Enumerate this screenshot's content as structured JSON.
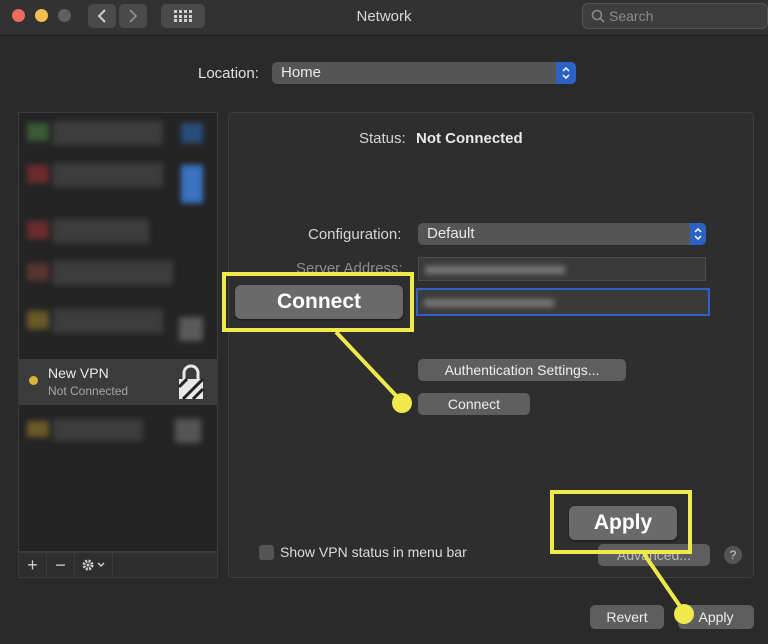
{
  "window": {
    "title": "Network",
    "search_placeholder": "Search"
  },
  "location": {
    "label": "Location:",
    "value": "Home"
  },
  "sidebar": {
    "vpn_item": {
      "name": "New VPN",
      "status": "Not Connected",
      "dot_color": "#d9b43d"
    },
    "add_label": "+",
    "remove_label": "−"
  },
  "panel": {
    "status_label": "Status:",
    "status_value": "Not Connected",
    "configuration_label": "Configuration:",
    "configuration_value": "Default",
    "server_address_label": "Server Address:",
    "auth_settings_label": "Authentication Settings...",
    "connect_label": "Connect",
    "show_vpn_status_label": "Show VPN status in menu bar",
    "advanced_label": "Advanced...",
    "help_label": "?"
  },
  "footer": {
    "revert_label": "Revert",
    "apply_label": "Apply"
  },
  "callouts": {
    "connect_label": "Connect",
    "apply_label": "Apply",
    "color": "#efe94c"
  },
  "colors": {
    "accent": "#2c62c6",
    "traffic_close": "#ec6a5e",
    "traffic_min": "#f4bf4f",
    "traffic_max": "#5f5f5f"
  }
}
